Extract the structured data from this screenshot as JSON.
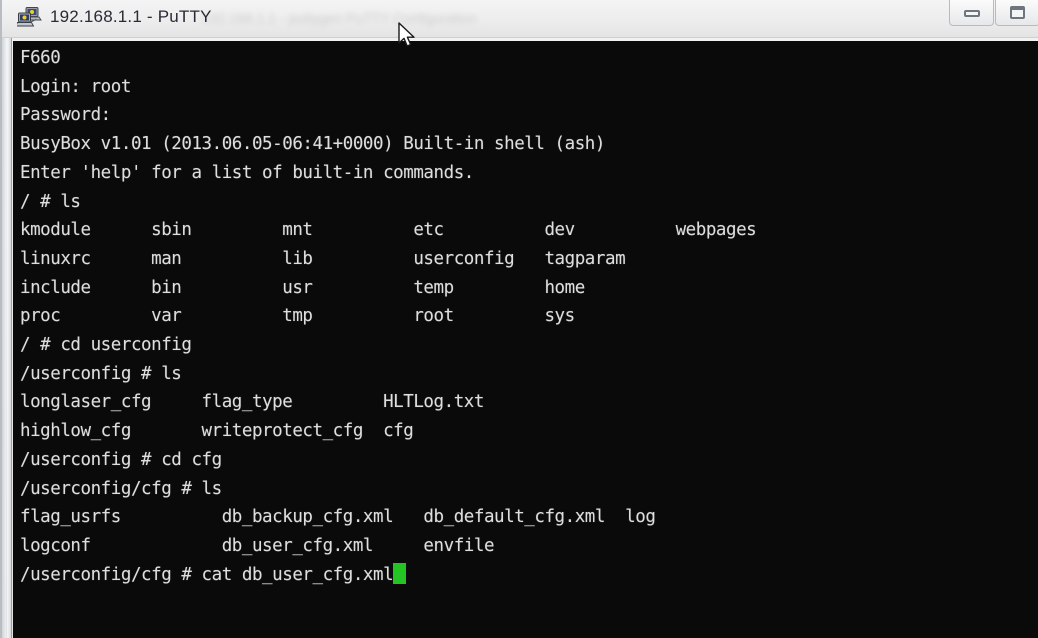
{
  "window": {
    "title": "192.168.1.1 - PuTTY",
    "ghost_text": "192.168.1.1 - puttygen  PuTTY Configuration",
    "icon_name": "putty-icon",
    "controls": {
      "minimize_label": "Minimize",
      "maximize_label": "Maximize"
    }
  },
  "terminal": {
    "background_color": "#0a0a0a",
    "foreground_color": "#dedede",
    "cursor_color": "#24c424",
    "prompt_symbol": "#",
    "lines": [
      "F660",
      "Login: root",
      "Password:",
      "",
      "BusyBox v1.01 (2013.06.05-06:41+0000) Built-in shell (ash)",
      "Enter 'help' for a list of built-in commands.",
      "",
      "/ # ls",
      "kmodule      sbin         mnt          etc          dev          webpages",
      "linuxrc      man          lib          userconfig   tagparam",
      "include      bin          usr          temp         home",
      "proc         var          tmp          root         sys",
      "/ # cd userconfig",
      "/userconfig # ls",
      "longlaser_cfg     flag_type         HLTLog.txt",
      "highlow_cfg       writeprotect_cfg  cfg",
      "/userconfig # cd cfg",
      "/userconfig/cfg # ls",
      "flag_usrfs          db_backup_cfg.xml   db_default_cfg.xml  log",
      "logconf             db_user_cfg.xml     envfile",
      "/userconfig/cfg # cat db_user_cfg.xml"
    ],
    "session_info": {
      "hostname_banner": "F660",
      "login_user": "root",
      "busybox_version": "v1.01",
      "busybox_build": "2013.06.05-06:41+0000",
      "shell": "ash"
    },
    "root_listing": [
      [
        "kmodule",
        "sbin",
        "mnt",
        "etc",
        "dev",
        "webpages"
      ],
      [
        "linuxrc",
        "man",
        "lib",
        "userconfig",
        "tagparam",
        ""
      ],
      [
        "include",
        "bin",
        "usr",
        "temp",
        "home",
        ""
      ],
      [
        "proc",
        "var",
        "tmp",
        "root",
        "sys",
        ""
      ]
    ],
    "userconfig_listing": [
      [
        "longlaser_cfg",
        "flag_type",
        "HLTLog.txt"
      ],
      [
        "highlow_cfg",
        "writeprotect_cfg",
        "cfg"
      ]
    ],
    "cfg_listing": [
      [
        "flag_usrfs",
        "db_backup_cfg.xml",
        "db_default_cfg.xml",
        "log"
      ],
      [
        "logconf",
        "db_user_cfg.xml",
        "envfile",
        ""
      ]
    ],
    "commands_entered": [
      "ls",
      "cd userconfig",
      "ls",
      "cd cfg",
      "ls",
      "cat db_user_cfg.xml"
    ],
    "current_command": "cat db_user_cfg.xml",
    "current_directory": "/userconfig/cfg"
  }
}
